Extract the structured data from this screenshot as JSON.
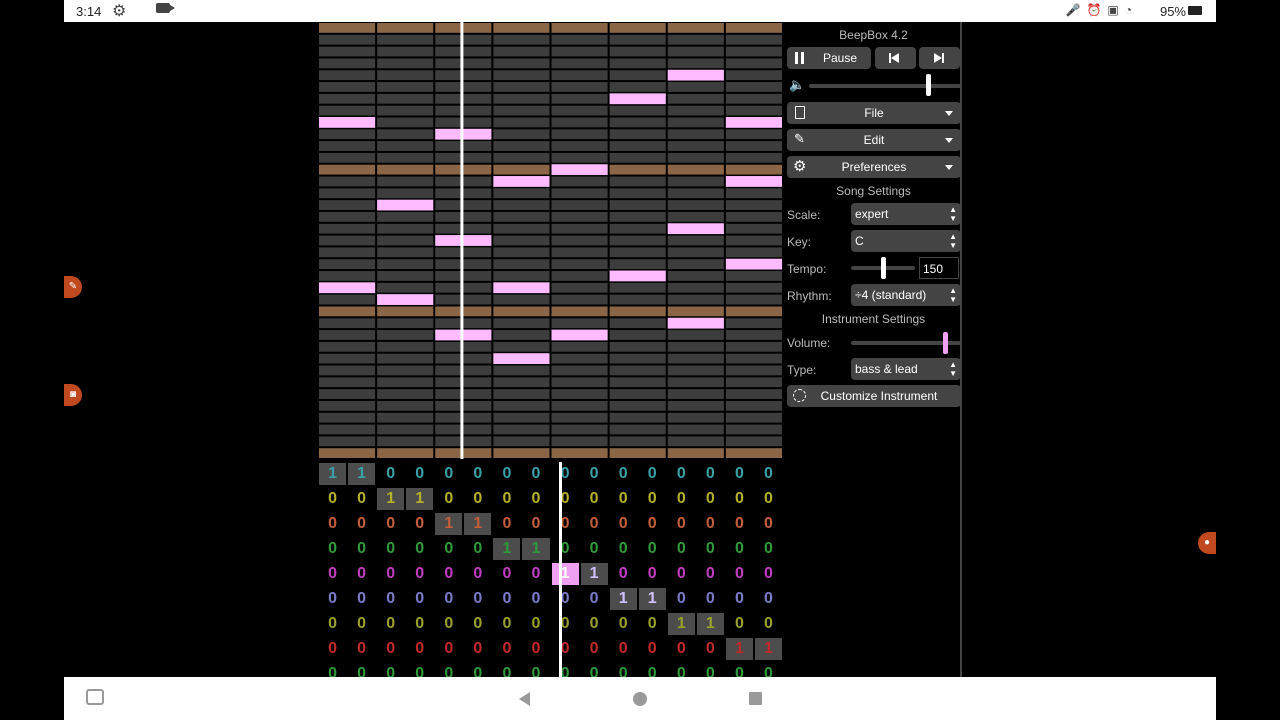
{
  "status": {
    "time": "3:14",
    "battery": "95%"
  },
  "app": {
    "title": "BeepBox 4.2",
    "pause_label": "Pause",
    "file_label": "File",
    "edit_label": "Edit",
    "preferences_label": "Preferences",
    "song_settings_label": "Song Settings",
    "scale_label": "Scale:",
    "scale_value": "expert",
    "key_label": "Key:",
    "key_value": "C",
    "tempo_label": "Tempo:",
    "tempo_value": "150",
    "rhythm_label": "Rhythm:",
    "rhythm_value": "÷4 (standard)",
    "instrument_settings_label": "Instrument Settings",
    "volume_label": "Volume:",
    "type_label": "Type:",
    "type_value": "bass & lead",
    "customize_label": "Customize Instrument",
    "master_volume": 0.78,
    "tempo_slider": 0.5,
    "instrument_volume": 0.85
  },
  "colors": {
    "note": "#ffbbff",
    "octave_row": "#8a6546",
    "row": "#3d3d3d",
    "accent": "#f0a0f0"
  },
  "piano_roll": {
    "notes": [
      {
        "beat": 0,
        "pitch": 28
      },
      {
        "beat": 0,
        "pitch": 14
      },
      {
        "beat": 1,
        "pitch": 21
      },
      {
        "beat": 1,
        "pitch": 13
      },
      {
        "beat": 2,
        "pitch": 27
      },
      {
        "beat": 2,
        "pitch": 18
      },
      {
        "beat": 2,
        "pitch": 10
      },
      {
        "beat": 3,
        "pitch": 23
      },
      {
        "beat": 3,
        "pitch": 14
      },
      {
        "beat": 3,
        "pitch": 8
      },
      {
        "beat": 4,
        "pitch": 24
      },
      {
        "beat": 4,
        "pitch": 10
      },
      {
        "beat": 5,
        "pitch": 30
      },
      {
        "beat": 5,
        "pitch": 15
      },
      {
        "beat": 6,
        "pitch": 32
      },
      {
        "beat": 6,
        "pitch": 19
      },
      {
        "beat": 6,
        "pitch": 11
      },
      {
        "beat": 7,
        "pitch": 28
      },
      {
        "beat": 7,
        "pitch": 23
      },
      {
        "beat": 7,
        "pitch": 16
      }
    ]
  },
  "pattern_editor": {
    "row_colors": [
      "#3aa0a8",
      "#b5b02a",
      "#c25e3a",
      "#2e9a3a",
      "#c23cc2",
      "#7b7bc8",
      "#9aa02a",
      "#c22a2a",
      "#2e9a3a"
    ],
    "rows": [
      [
        1,
        1,
        0,
        0,
        0,
        0,
        0,
        0,
        0,
        0,
        0,
        0,
        0,
        0,
        0,
        0
      ],
      [
        0,
        0,
        1,
        1,
        0,
        0,
        0,
        0,
        0,
        0,
        0,
        0,
        0,
        0,
        0,
        0
      ],
      [
        0,
        0,
        0,
        0,
        1,
        1,
        0,
        0,
        0,
        0,
        0,
        0,
        0,
        0,
        0,
        0
      ],
      [
        0,
        0,
        0,
        0,
        0,
        0,
        1,
        1,
        0,
        0,
        0,
        0,
        0,
        0,
        0,
        0
      ],
      [
        0,
        0,
        0,
        0,
        0,
        0,
        0,
        0,
        1,
        1,
        0,
        0,
        0,
        0,
        0,
        0
      ],
      [
        0,
        0,
        0,
        0,
        0,
        0,
        0,
        0,
        0,
        0,
        1,
        1,
        0,
        0,
        0,
        0
      ],
      [
        0,
        0,
        0,
        0,
        0,
        0,
        0,
        0,
        0,
        0,
        0,
        0,
        1,
        1,
        0,
        0
      ],
      [
        0,
        0,
        0,
        0,
        0,
        0,
        0,
        0,
        0,
        0,
        0,
        0,
        0,
        0,
        1,
        1
      ],
      [
        0,
        0,
        0,
        0,
        0,
        0,
        0,
        0,
        0,
        0,
        0,
        0,
        0,
        0,
        0,
        0
      ]
    ],
    "selected": {
      "row": 4,
      "col": 8
    }
  }
}
